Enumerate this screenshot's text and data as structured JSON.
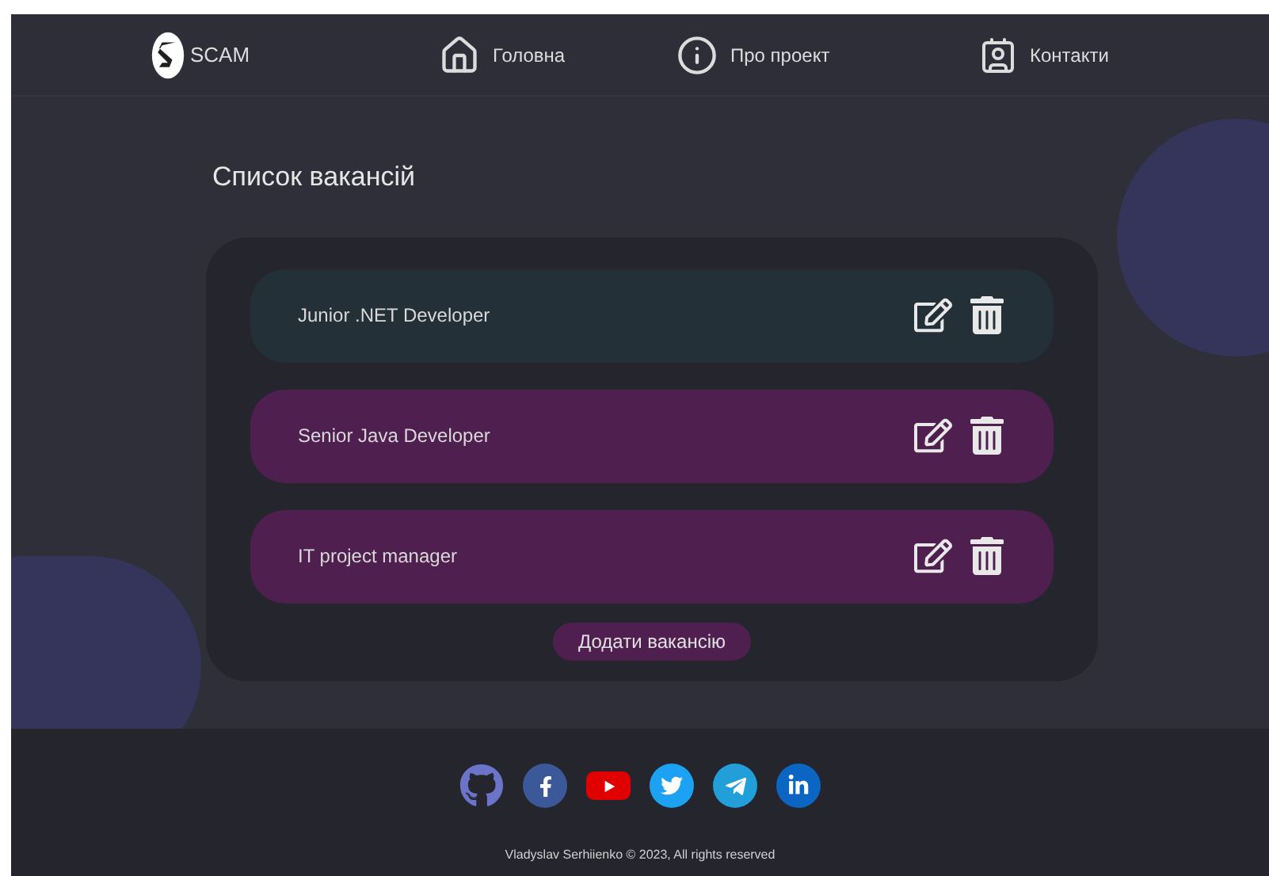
{
  "header": {
    "logo": "SCAM",
    "nav": [
      {
        "kind": "home",
        "label": "Головна"
      },
      {
        "kind": "info",
        "label": "Про проект"
      },
      {
        "kind": "contacts",
        "label": "Контакти"
      }
    ]
  },
  "page_title": "Список вакансій",
  "vacancies": [
    {
      "title": "Junior .NET Developer",
      "selected": true
    },
    {
      "title": "Senior Java Developer",
      "selected": false
    },
    {
      "title": "IT project manager",
      "selected": false
    }
  ],
  "add_button": "Додати вакансію",
  "footer": {
    "socials": [
      {
        "kind": "github"
      },
      {
        "kind": "facebook"
      },
      {
        "kind": "youtube"
      },
      {
        "kind": "twitter"
      },
      {
        "kind": "telegram"
      },
      {
        "kind": "linkedin"
      }
    ],
    "copyright": "Vladyslav Serhiienko © 2023, All rights reserved"
  }
}
